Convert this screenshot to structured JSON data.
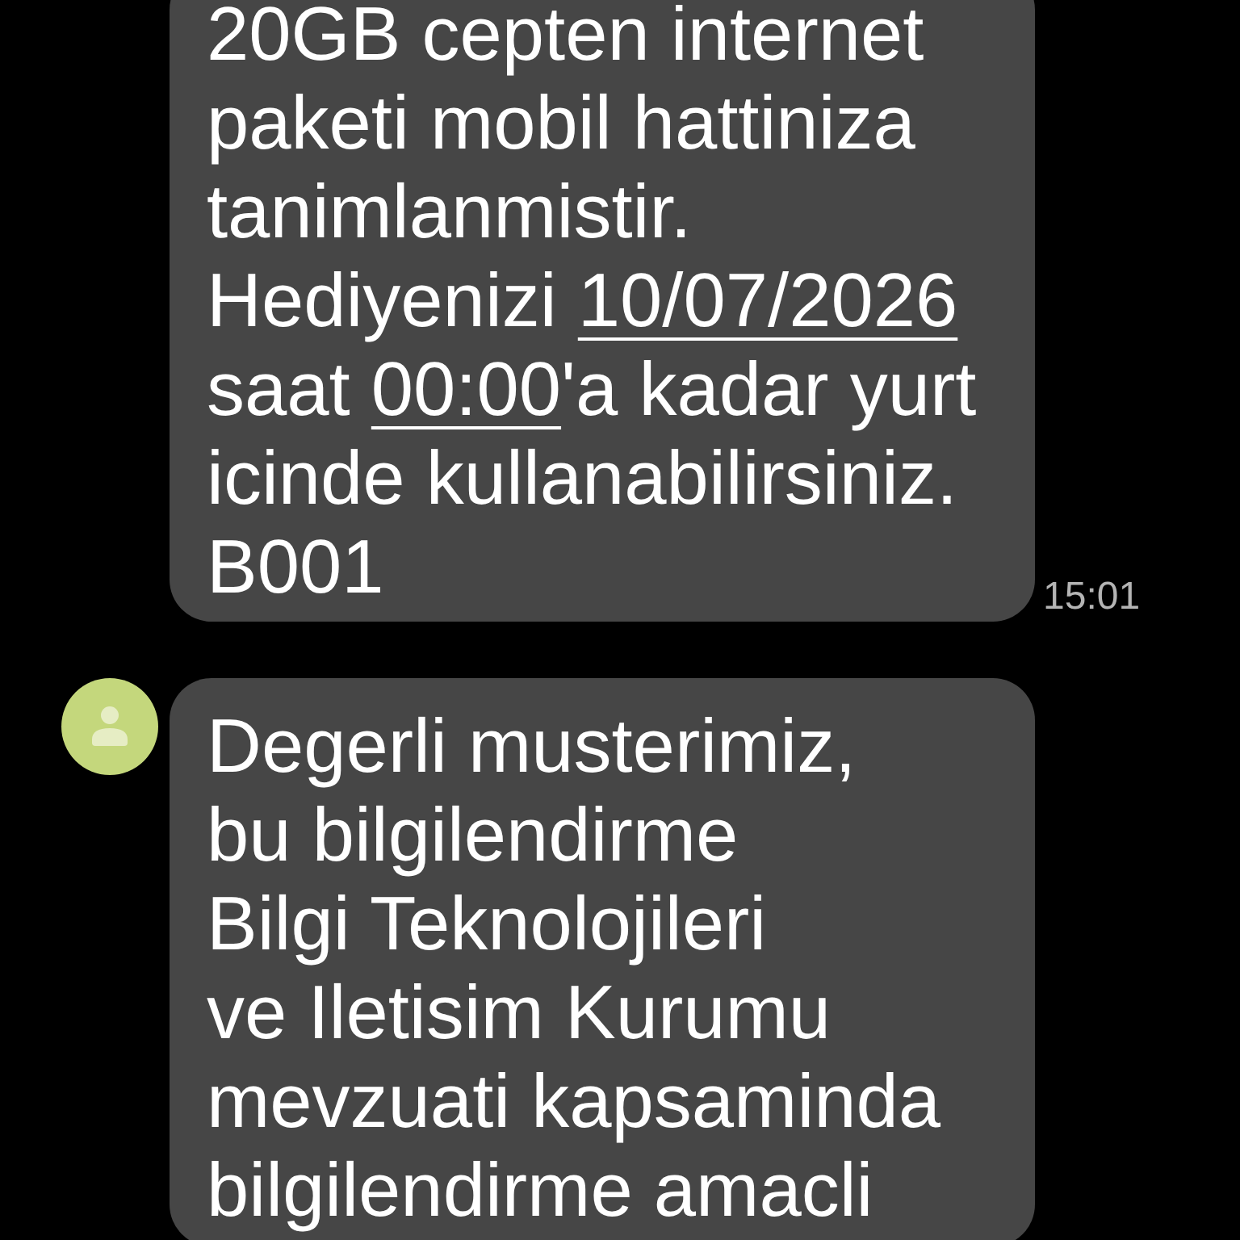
{
  "conversation": {
    "messages": [
      {
        "show_avatar": false,
        "segments": [
          {
            "kind": "text",
            "text": "20GB cepten internet\npaketi mobil hattiniza\ntanimlanmistir.\nHediyenizi "
          },
          {
            "kind": "date",
            "text": "10/07/2026"
          },
          {
            "kind": "text",
            "text": "\nsaat "
          },
          {
            "kind": "time",
            "text": "00:00"
          },
          {
            "kind": "text",
            "text": "'a kadar yurt\nicinde kullanabilirsiniz.\nB001"
          }
        ],
        "time": "15:01"
      },
      {
        "show_avatar": true,
        "segments": [
          {
            "kind": "text",
            "text": "Degerli musterimiz,\nbu bilgilendirme\nBilgi Teknolojileri\nve Iletisim Kurumu\nmevzuati kapsaminda\nbilgilendirme amacli"
          }
        ]
      }
    ]
  }
}
